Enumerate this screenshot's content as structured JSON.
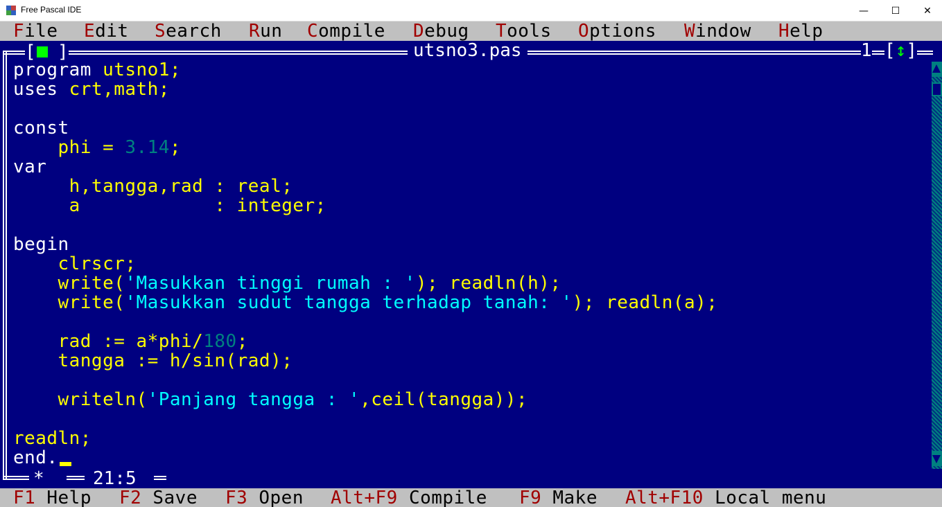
{
  "window": {
    "title": "Free Pascal IDE",
    "minimize_glyph": "—",
    "maximize_glyph": "☐",
    "close_glyph": "✕"
  },
  "menu": [
    {
      "hotkey": "F",
      "rest": "ile"
    },
    {
      "hotkey": "E",
      "rest": "dit"
    },
    {
      "hotkey": "S",
      "rest": "earch"
    },
    {
      "hotkey": "R",
      "rest": "un"
    },
    {
      "hotkey": "C",
      "rest": "ompile"
    },
    {
      "hotkey": "D",
      "rest": "ebug"
    },
    {
      "hotkey": "T",
      "rest": "ools"
    },
    {
      "hotkey": "O",
      "rest": "ptions"
    },
    {
      "hotkey": "W",
      "rest": "indow"
    },
    {
      "hotkey": "H",
      "rest": "elp"
    }
  ],
  "editor": {
    "close_box_left": "[",
    "close_box_right": "]",
    "file_name": "utsno3.pas",
    "window_number": "1",
    "zoom_left": "[",
    "zoom_arrow": "↕",
    "zoom_right": "]",
    "modified_marker": "*",
    "cursor_position": "21:5",
    "code_lines": [
      [
        {
          "t": "program ",
          "c": "kw"
        },
        {
          "t": "utsno1;",
          "c": "id"
        }
      ],
      [
        {
          "t": "uses ",
          "c": "kw"
        },
        {
          "t": "crt,math;",
          "c": "id"
        }
      ],
      [],
      [
        {
          "t": "const",
          "c": "kw"
        }
      ],
      [
        {
          "t": "    phi = ",
          "c": "id"
        },
        {
          "t": "3.14",
          "c": "num"
        },
        {
          "t": ";",
          "c": "id"
        }
      ],
      [
        {
          "t": "var",
          "c": "kw"
        }
      ],
      [
        {
          "t": "     h,tangga,rad : real;",
          "c": "id"
        }
      ],
      [
        {
          "t": "     a            : integer;",
          "c": "id"
        }
      ],
      [],
      [
        {
          "t": "begin",
          "c": "kw"
        }
      ],
      [
        {
          "t": "    clrscr;",
          "c": "id"
        }
      ],
      [
        {
          "t": "    write(",
          "c": "id"
        },
        {
          "t": "'Masukkan tinggi rumah : '",
          "c": "str"
        },
        {
          "t": "); readln(h);",
          "c": "id"
        }
      ],
      [
        {
          "t": "    write(",
          "c": "id"
        },
        {
          "t": "'Masukkan sudut tangga terhadap tanah: '",
          "c": "str"
        },
        {
          "t": "); readln(a);",
          "c": "id"
        }
      ],
      [],
      [
        {
          "t": "    rad := a*phi/",
          "c": "id"
        },
        {
          "t": "180",
          "c": "num"
        },
        {
          "t": ";",
          "c": "id"
        }
      ],
      [
        {
          "t": "    tangga := h/sin(rad);",
          "c": "id"
        }
      ],
      [],
      [
        {
          "t": "    writeln(",
          "c": "id"
        },
        {
          "t": "'Panjang tangga : '",
          "c": "str"
        },
        {
          "t": ",ceil(tangga));",
          "c": "id"
        }
      ],
      [],
      [
        {
          "t": "readln;",
          "c": "id"
        }
      ],
      [
        {
          "t": "end.",
          "c": "kw"
        }
      ]
    ]
  },
  "statusbar": [
    {
      "key": "F1",
      "label": " Help"
    },
    {
      "key": "F2",
      "label": " Save"
    },
    {
      "key": "F3",
      "label": " Open"
    },
    {
      "key": "Alt+F9",
      "label": " Compile"
    },
    {
      "key": "F9",
      "label": " Make"
    },
    {
      "key": "Alt+F10",
      "label": " Local menu"
    }
  ],
  "colors": {
    "editor_bg": "#000080",
    "menu_bg": "#c0c0c0",
    "hotkey": "#a00000",
    "identifier": "#ffff00",
    "keyword": "#ffffff",
    "string": "#00ffff",
    "number": "#008080",
    "frame_accent": "#00ff00"
  }
}
